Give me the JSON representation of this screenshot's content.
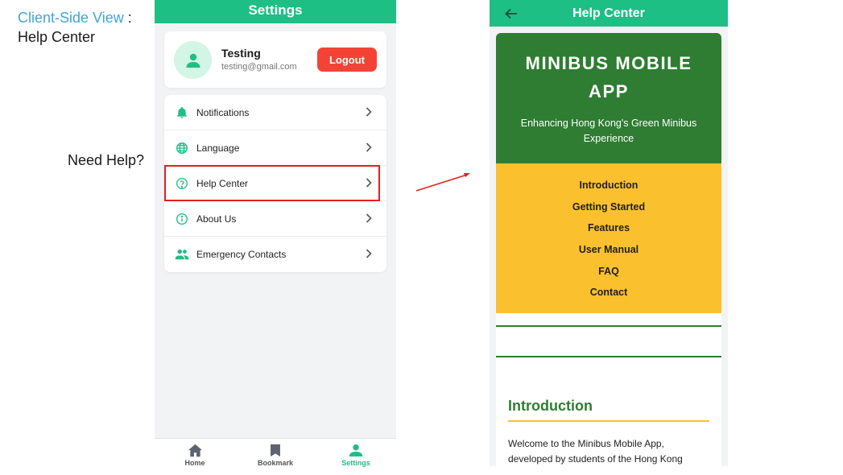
{
  "slide": {
    "caption_accent": "Client-Side View",
    "caption_sep": " :",
    "caption_title": "Help Center",
    "need_help": "Need Help?"
  },
  "settings": {
    "header_title": "Settings",
    "profile": {
      "name": "Testing",
      "email": "testing@gmail.com",
      "logout_label": "Logout"
    },
    "menu": [
      {
        "label": "Notifications",
        "icon": "bell-icon"
      },
      {
        "label": "Language",
        "icon": "globe-icon"
      },
      {
        "label": "Help Center",
        "icon": "help-circle-icon"
      },
      {
        "label": "About Us",
        "icon": "info-icon"
      },
      {
        "label": "Emergency Contacts",
        "icon": "people-icon"
      }
    ],
    "bottom_nav": [
      {
        "label": "Home",
        "icon": "home-icon"
      },
      {
        "label": "Bookmark",
        "icon": "bookmark-icon"
      },
      {
        "label": "Settings",
        "icon": "person-icon",
        "active": true
      }
    ]
  },
  "help_center": {
    "header_title": "Help Center",
    "hero_title_line1": "MINIBUS MOBILE",
    "hero_title_line2": "APP",
    "hero_subtitle": "Enhancing Hong Kong's Green Minibus Experience",
    "toc": [
      "Introduction",
      "Getting Started",
      "Features",
      "User Manual",
      "FAQ",
      "Contact"
    ],
    "section_title": "Introduction",
    "section_text": "Welcome to the Minibus Mobile App, developed by students of the Hong Kong"
  },
  "colors": {
    "brand_green": "#1dbf84",
    "dark_green": "#2e7d32",
    "yellow": "#fbc02d",
    "logout_red": "#f44336",
    "highlight_red": "#e02020",
    "caption_blue": "#3fa7d6"
  }
}
